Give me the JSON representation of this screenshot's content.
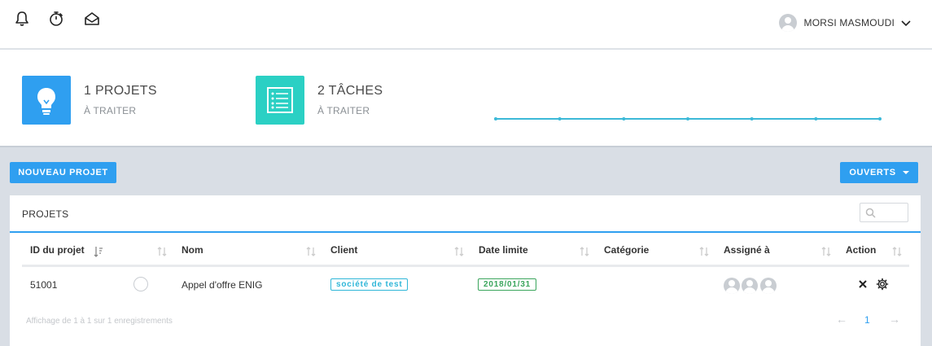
{
  "header": {
    "icons": [
      "bell-icon",
      "stopwatch-icon",
      "envelope-icon"
    ],
    "user_name": "MORSI MASMOUDI"
  },
  "stats": [
    {
      "count": "1 PROJETS",
      "sub": "À TRAITER",
      "icon": "lightbulb-icon",
      "color": "#2f9ff0"
    },
    {
      "count": "2 TÂCHES",
      "sub": "À TRAITER",
      "icon": "checklist-icon",
      "color": "#2bd0c4"
    }
  ],
  "sparkline": {
    "points": [
      0,
      0,
      0,
      0,
      0,
      0,
      0
    ],
    "color": "#3cb9d8"
  },
  "toolbar": {
    "new_label": "NOUVEAU PROJET",
    "filter_label": "OUVERTS"
  },
  "panel": {
    "title": "PROJETS",
    "columns": [
      "ID du projet",
      "Nom",
      "Client",
      "Date limite",
      "Catégorie",
      "Assigné à",
      "Action"
    ],
    "rows": [
      {
        "id": "51001",
        "name": "Appel d'offre ENIG",
        "client": "société de test",
        "date": "2018/01/31",
        "category": "",
        "assignees": 3
      }
    ],
    "info": "Affichage de 1 à 1 sur 1 enregistrements",
    "pager": {
      "prev": "←",
      "page": "1",
      "next": "→"
    }
  },
  "colors": {
    "accent": "#2f9ff0",
    "teal": "#2bd0c4",
    "client_tag": "#2fb6d8",
    "date_tag": "#3aa55c"
  }
}
